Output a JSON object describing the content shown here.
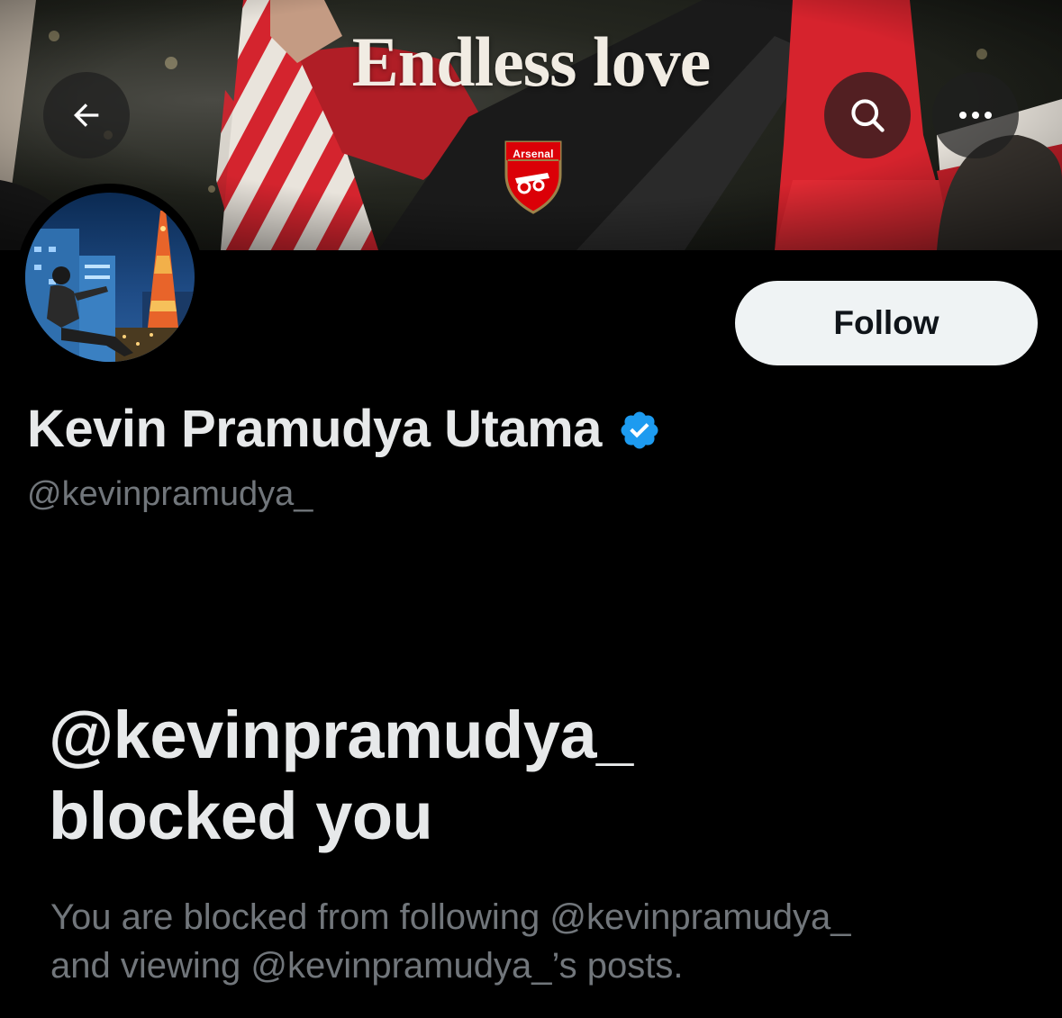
{
  "banner": {
    "title": "Endless love",
    "crest_label": "Arsenal"
  },
  "header": {
    "back_icon": "arrow-left-icon",
    "search_icon": "search-icon",
    "more_icon": "more-horizontal-icon"
  },
  "profile": {
    "display_name": "Kevin Pramudya Utama",
    "handle": "@kevinpramudya_",
    "verified": true,
    "verified_color": "#1d9bf0",
    "follow_label": "Follow"
  },
  "blocked": {
    "title_line1": "@kevinpramudya_",
    "title_line2": "blocked you",
    "description_line1": "You are blocked from following @kevinpramudya_",
    "description_line2": "and viewing @kevinpramudya_’s posts."
  },
  "colors": {
    "background": "#000000",
    "text_primary": "#e7e9ea",
    "text_secondary": "#71767b",
    "follow_button_bg": "#eff3f4"
  }
}
